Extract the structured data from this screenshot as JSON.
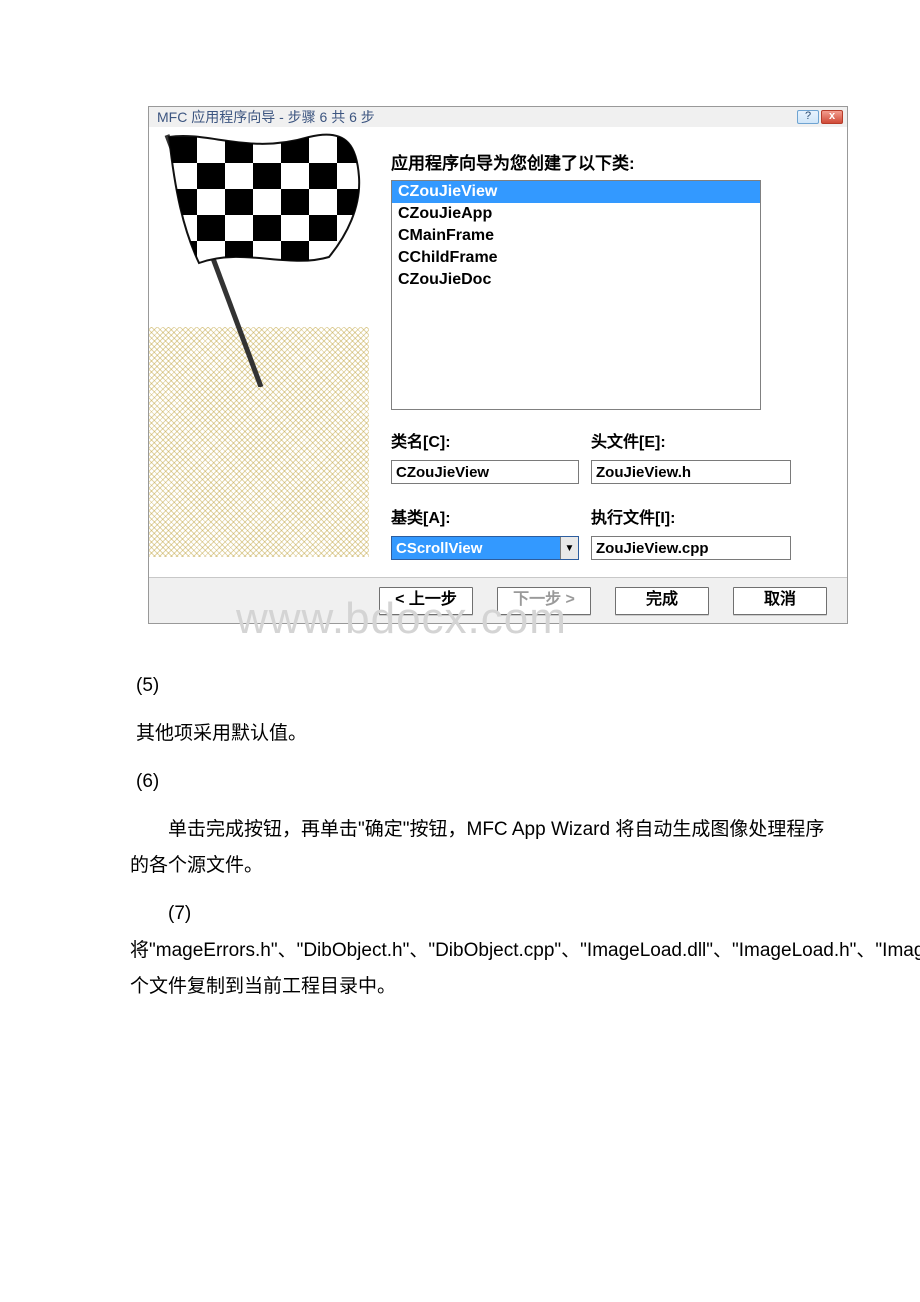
{
  "dialog": {
    "title": "MFC 应用程序向导 - 步骤 6 共 6 步",
    "classes_label": "应用程序向导为您创建了以下类:",
    "list_items": [
      "CZouJieView",
      "CZouJieApp",
      "CMainFrame",
      "CChildFrame",
      "CZouJieDoc"
    ],
    "selected_index": 0,
    "fields": {
      "class_name_label": "类名[C]:",
      "class_name_value": "CZouJieView",
      "header_label": "头文件[E]:",
      "header_value": "ZouJieView.h",
      "base_label": "基类[A]:",
      "base_value": "CScrollView",
      "impl_label": "执行文件[I]:",
      "impl_value": "ZouJieView.cpp"
    },
    "buttons": {
      "prev": "< 上一步",
      "next": "下一步 >",
      "finish": "完成",
      "cancel": "取消"
    }
  },
  "watermark": "www.bdocx.com",
  "body_text": {
    "p1": "(5)",
    "p2": "其他项采用默认值。",
    "p3": "(6)",
    "p4": "单击完成按钮，再单击\"确定\"按钮，MFC App Wizard 将自动生成图像处理程序的各个源文件。",
    "p5": "(7)将\"mageErrors.h\"、\"DibObject.h\"、\"DibObject.cpp\"、\"ImageLoad.dll\"、\"ImageLoad.h\"、\"ImageLoad.lib\"六个文件复制到当前工程目录中。"
  }
}
